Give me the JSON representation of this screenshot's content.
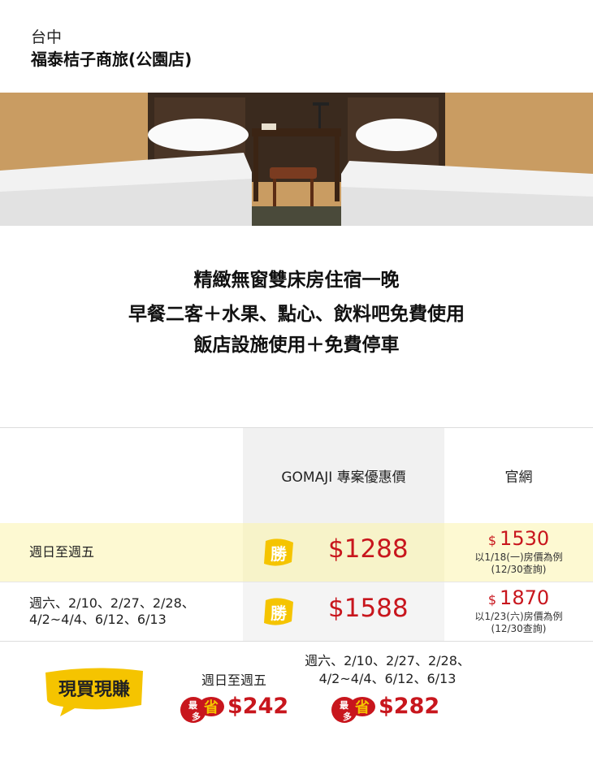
{
  "header": {
    "location": "台中",
    "hotel_name": "福泰桔子商旅(公園店)"
  },
  "photo": {
    "alt": "hotel-room-photo"
  },
  "highlights": {
    "line1": "精緻無窗雙床房住宿一晚",
    "line2": "早餐二客＋水果、點心、飲料吧免費使用",
    "line3": "飯店設施使用＋免費停車"
  },
  "price_table": {
    "col_gomaji": "GOMAJI 專案優惠價",
    "col_official": "官網",
    "badge_text": "勝",
    "rows": [
      {
        "label": "週日至週五",
        "gomaji_price": "$1288",
        "official_currency": "$",
        "official_price": "1530",
        "note_line1": "以1/18(一)房價為例",
        "note_line2": "(12/30查詢)"
      },
      {
        "label_line1": "週六、2/10、2/27、2/28、",
        "label_line2": "4/2~4/4、6/12、6/13",
        "gomaji_price": "$1588",
        "official_currency": "$",
        "official_price": "1870",
        "note_line1": "以1/23(六)房價為例",
        "note_line2": "(12/30查詢)"
      }
    ]
  },
  "savings": {
    "logo_text": "現買現賺",
    "weekday_label": "週日至週五",
    "weekend_label_line1": "週六、2/10、2/27、2/28、",
    "weekend_label_line2": "4/2~4/4、6/12、6/13",
    "most_label_a": "最",
    "most_label_b": "多",
    "save_label": "省",
    "weekday_amount": "$242",
    "weekend_amount": "$282"
  },
  "colors": {
    "price_red": "#c8161d",
    "badge_yellow": "#f5c400",
    "row_highlight": "#fdf9d2"
  }
}
